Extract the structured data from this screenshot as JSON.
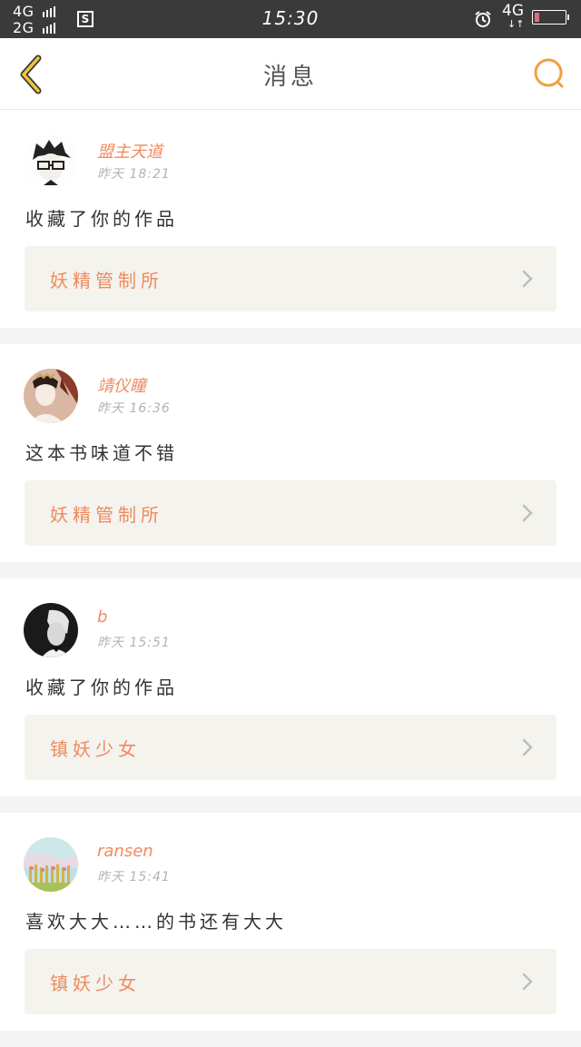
{
  "status_bar": {
    "signal_top": "4G",
    "signal_bottom": "2G",
    "time": "15:30",
    "network": "4G",
    "sim_icon": "S",
    "battery_level": 0.15,
    "battery_color": "#e46b7d"
  },
  "nav": {
    "title": "消息",
    "back_icon": "chevron-left-icon",
    "search_icon": "search-icon",
    "accent": "#f0a040"
  },
  "messages": [
    {
      "name": "盟主天道",
      "time": "昨天  18:21",
      "text": "收藏了你的作品",
      "book": "妖精管制所"
    },
    {
      "name": "靖仪瞳",
      "time": "昨天  16:36",
      "text": "这本书味道不错",
      "book": "妖精管制所"
    },
    {
      "name": "b",
      "time": "昨天  15:51",
      "text": "收藏了你的作品",
      "book": "镇妖少女"
    },
    {
      "name": "ransen",
      "time": "昨天  15:41",
      "text": "喜欢大大……的书还有大大",
      "book": "镇妖少女"
    }
  ],
  "colors": {
    "accent": "#f08a5d",
    "time": "#b3b3b3",
    "book_bg": "#f4f3ee"
  }
}
